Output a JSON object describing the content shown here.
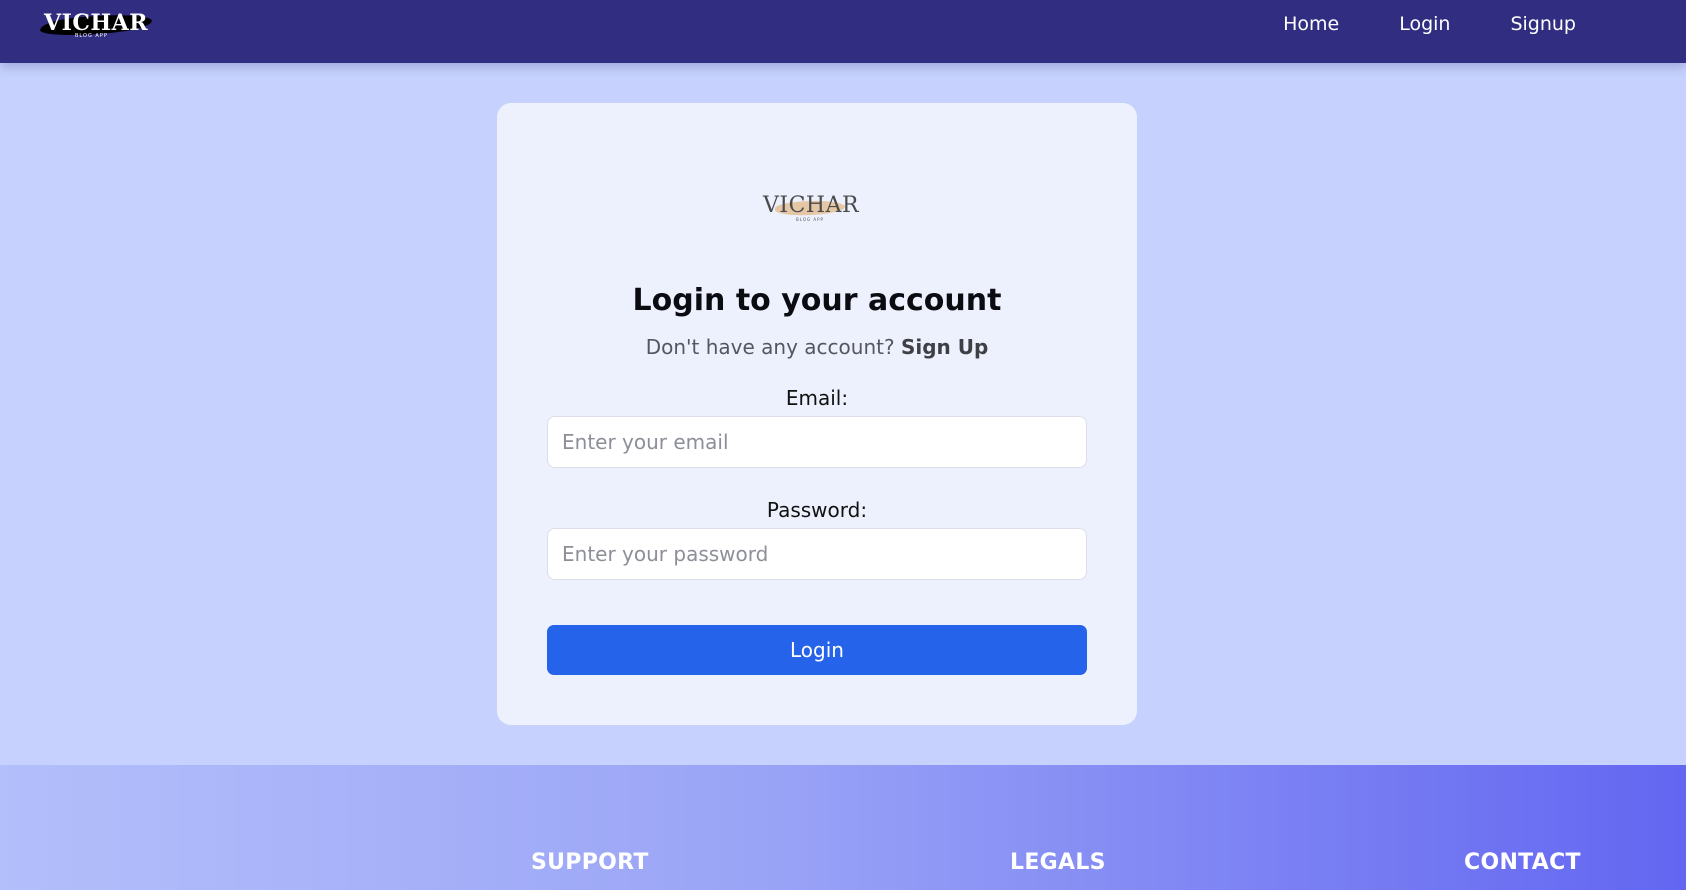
{
  "navbar": {
    "brand_word": "VICHAR",
    "brand_tag": "BLOG APP",
    "links": [
      "Home",
      "Login",
      "Signup"
    ]
  },
  "card": {
    "logo_word": "VICHAR",
    "logo_tag": "BLOG APP",
    "title": "Login to your account",
    "subtitle_prefix": "Don't have any account?",
    "subtitle_link": "Sign Up",
    "email_label": "Email:",
    "email_placeholder": "Enter your email",
    "password_label": "Password:",
    "password_placeholder": "Enter your password",
    "login_button": "Login"
  },
  "footer": {
    "support": "SUPPORT",
    "legals": "LEGALS",
    "contact": "CONTACT"
  },
  "colors": {
    "navbar": "#312e81",
    "page_bg": "#c6d2fd",
    "card_bg": "#edf1fd",
    "button": "#2563eb",
    "footer_end": "#6366f1"
  }
}
